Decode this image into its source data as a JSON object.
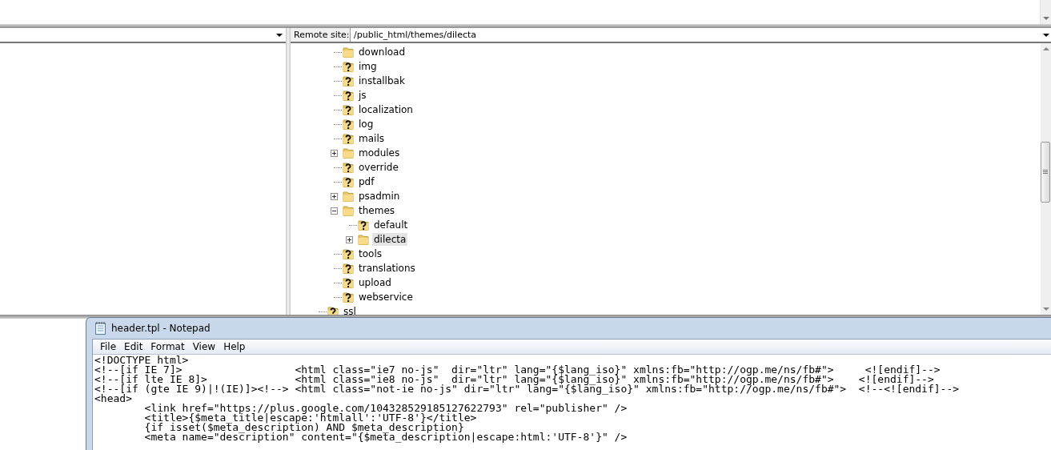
{
  "remote_site": {
    "label": "Remote site:",
    "path": "/public_html/themes/dilecta"
  },
  "tree": {
    "items": [
      {
        "children": [
          {
            "label": "download",
            "kind": "folder",
            "selected": false
          },
          {
            "label": "img",
            "kind": "unknown",
            "selected": false
          },
          {
            "label": "installbak",
            "kind": "unknown",
            "selected": false
          },
          {
            "label": "js",
            "kind": "unknown",
            "selected": false
          },
          {
            "label": "localization",
            "kind": "unknown",
            "selected": false
          },
          {
            "label": "log",
            "kind": "unknown",
            "selected": false
          },
          {
            "label": "mails",
            "kind": "unknown",
            "selected": false
          },
          {
            "label": "modules",
            "kind": "folder",
            "selected": false,
            "expanded": false
          },
          {
            "label": "override",
            "kind": "unknown",
            "selected": false
          },
          {
            "label": "pdf",
            "kind": "unknown",
            "selected": false
          },
          {
            "label": "psadmin",
            "kind": "folder",
            "selected": false,
            "expanded": false
          },
          {
            "label": "themes",
            "kind": "folder",
            "selected": false,
            "expanded": true,
            "children": [
              {
                "label": "default",
                "kind": "unknown",
                "selected": false
              },
              {
                "label": "dilecta",
                "kind": "folder",
                "selected": true,
                "expanded": false
              }
            ]
          },
          {
            "label": "tools",
            "kind": "unknown",
            "selected": false
          },
          {
            "label": "translations",
            "kind": "unknown",
            "selected": false
          },
          {
            "label": "upload",
            "kind": "unknown",
            "selected": false
          },
          {
            "label": "webservice",
            "kind": "unknown",
            "selected": false
          }
        ]
      },
      {
        "label": "ssl",
        "kind": "unknown",
        "selected": false
      }
    ]
  },
  "notepad": {
    "title": "header.tpl - Notepad",
    "menu": [
      "File",
      "Edit",
      "Format",
      "View",
      "Help"
    ],
    "lines": [
      "<!DOCTYPE html>",
      "<!--[if IE 7]>                  <html class=\"ie7 no-js\"  dir=\"ltr\" lang=\"{$lang_iso}\" xmlns:fb=\"http://ogp.me/ns/fb#\">     <![endif]-->",
      "<!--[if lte IE 8]>              <html class=\"ie8 no-js\"  dir=\"ltr\" lang=\"{$lang_iso}\" xmlns:fb=\"http://ogp.me/ns/fb#\">    <![endif]-->",
      "<!--[if (gte IE 9)|!(IE)]><!--> <html class=\"not-ie no-js\" dir=\"ltr\" lang=\"{$lang_iso}\" xmlns:fb=\"http://ogp.me/ns/fb#\">  <!--<![endif]-->",
      "<head>",
      "        <link href=\"https://plus.google.com/104328529185127622793\" rel=\"publisher\" />",
      "        <title>{$meta_title|escape:'htmlall':'UTF-8'}</title>",
      "        {if isset($meta_description) AND $meta_description}",
      "        <meta name=\"description\" content=\"{$meta_description|escape:html:'UTF-8'}\" />"
    ]
  }
}
